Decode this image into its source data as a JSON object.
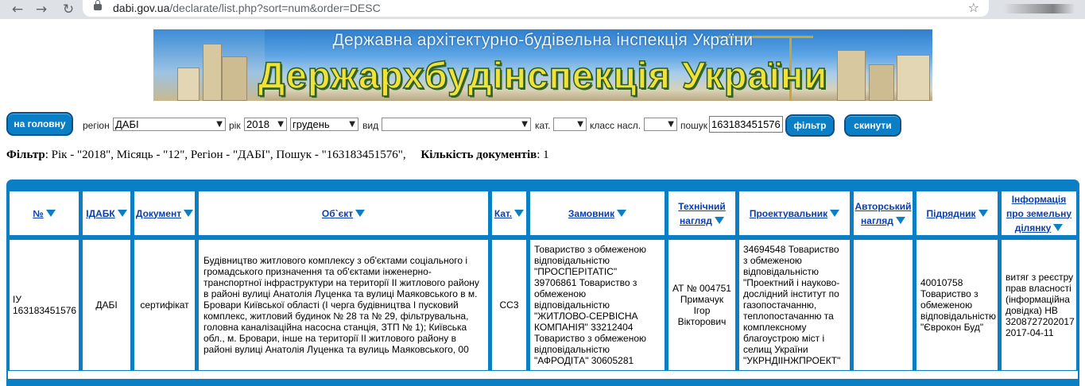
{
  "browser": {
    "url_host": "dabi.gov.ua",
    "url_path": "/declarate/list.php?sort=num&order=DESC"
  },
  "banner": {
    "subtitle": "Державна архітектурно-будівельна інспекція України",
    "title": "Держархбудінспекція України"
  },
  "filter": {
    "home_label": "на головну",
    "region_label": "регіон",
    "region_value": "ДАБІ",
    "year_label": "рік",
    "year_value": "2018",
    "month_value": "грудень",
    "type_label": "вид",
    "type_value": "",
    "cat_label": "кат.",
    "cat_value": "",
    "class_label": "класс насл.",
    "class_value": "",
    "search_label": "пошук",
    "search_value": "163183451576",
    "filter_button": "фільтр",
    "reset_button": "скинути"
  },
  "filter_info": {
    "label": "Фільтр",
    "text": ": Рік - \"2018\", Місяць - \"12\", Регіон - \"ДАБІ\", Пошук - \"163183451576\",",
    "count_label": "Кількість документів",
    "count_value": ": 1"
  },
  "table": {
    "headers": {
      "num": "№",
      "idabk": "ІДАБК",
      "doc": "Документ",
      "object": "Об`єкт",
      "cat": "Кат.",
      "customer_l1": "Замовник",
      "tech_l1": "Технічний",
      "tech_l2": "нагляд",
      "designer": "Проектувальник",
      "author_l1": "Авторський",
      "author_l2": "нагляд",
      "contractor": "Підрядник",
      "land_l1": "Інформація",
      "land_l2": "про земельну",
      "land_l3": "ділянку"
    },
    "row": {
      "num_l1": "ІУ",
      "num_l2": "163183451576",
      "idabk": "ДАБІ",
      "doc": "сертифікат",
      "object": "Будівництво житлового комплексу з об'єктами соціального і громадського призначення та об'єктами інженерно-транспортної інфраструктури на території ІІ житлового району в районі вулиці Анатолія Луценка та вулиці Маяковського в м. Бровари Київської області (І черга будівництва І пусковий комплекс, житловий будинок № 28 та № 29, фільтрувальна, головна каналізаційна насосна станція, ЗТП № 1); Київська обл., м. Бровари, інше на території ІІ житлового району в районі вулиці Анатолія Луценка та вулиць Маяковського, 00",
      "cat": "СС3",
      "customer": "Товариство з обмеженою відповідальністю \"ПРОСПЕРІТАТІС\" 39706861 Товариство з обмеженою відповідальністю \"ЖИТЛОВО-СЕРВІСНА КОМПАНІЯ\" 33212404 Товариство з обмеженою відповідальністю \"АФРОДІТА\" 30605281",
      "tech_l1": "АТ № 004751",
      "tech_l2": "Примачук",
      "tech_l3": "Ігор",
      "tech_l4": "Вікторович",
      "designer": "34694548 Товариство з обмеженою відповідальністю \"Проектний і науково-дослідний інститут по газопостачанню, теплопостачанню та комплексному благоустрою міст і селищ України \"УКРНДІІНЖПРОЕКТ\"",
      "author": "",
      "contractor": "40010758 Товариство з обмеженою відповідальністю \"Єврокон Буд\"",
      "land": "витяг з реєстру прав власності (інформаційна довідка) НВ 3208727202017 2017-04-11"
    }
  }
}
